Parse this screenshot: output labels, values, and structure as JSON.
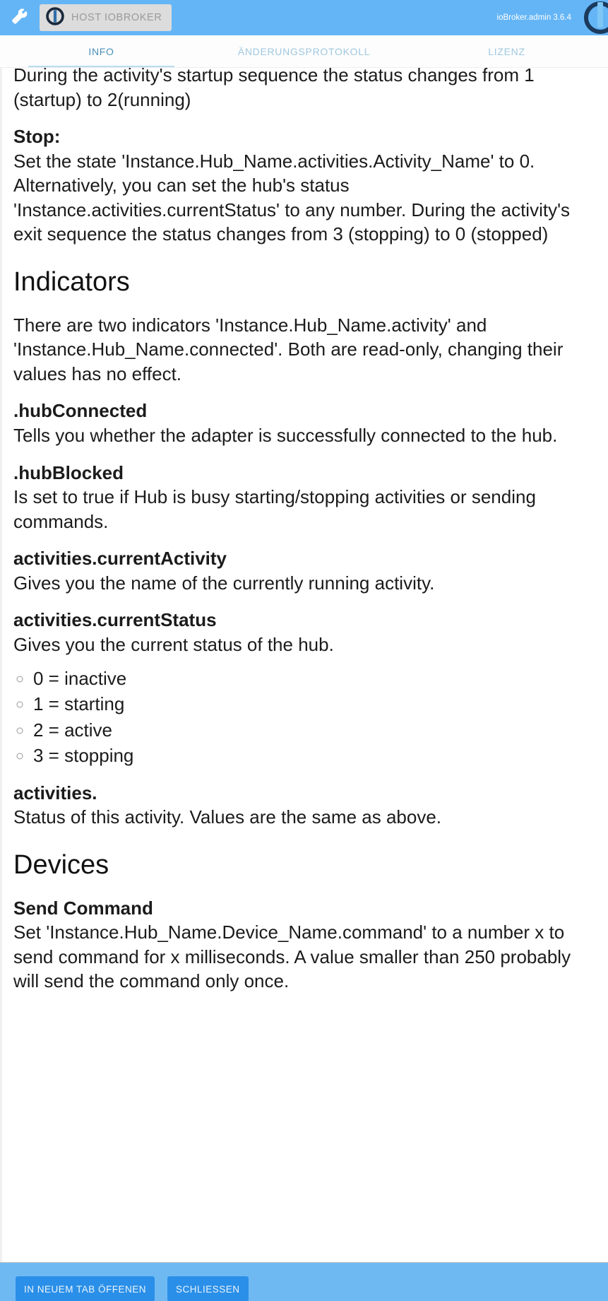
{
  "appbar": {
    "menu_icon": "wrench-icon",
    "host_chip_label": "HOST IOBROKER",
    "host_chip_icon": "iobroker-logo-icon",
    "version_label": "ioBroker.admin 3.6.4",
    "corner_icon": "iobroker-logo-icon",
    "background_color": "#64b5f6"
  },
  "tabs": [
    {
      "label": "INFO",
      "active": true
    },
    {
      "label": "ÄNDERUNGSPROTOKOLL",
      "active": false
    },
    {
      "label": "LIZENZ",
      "active": false
    }
  ],
  "tab_colors": {
    "active_text": "#4a90b8",
    "inactive_text": "#9fc8e0",
    "indicator": "#b9dcee"
  },
  "document": {
    "intro_clipped": "During the activity's startup sequence the status changes from 1 (startup) to 2(running)",
    "stop_heading": "Stop:",
    "stop_body": "Set the state 'Instance.Hub_Name.activities.Activity_Name' to 0. Alternatively, you can set the hub's status 'Instance.activities.currentStatus' to any number. During the activity's exit sequence the status changes from 3 (stopping) to 0 (stopped)",
    "indicators_heading": "Indicators",
    "indicators_intro": "There are two indicators 'Instance.Hub_Name.activity' and 'Instance.Hub_Name.connected'. Both are read-only, changing their values has no effect.",
    "entries": [
      {
        "term": ".hubConnected",
        "desc": "Tells you whether the adapter is successfully connected to the hub."
      },
      {
        "term": ".hubBlocked",
        "desc": "Is set to true if Hub is busy starting/stopping activities or sending commands."
      },
      {
        "term": "activities.currentActivity",
        "desc": "Gives you the name of the currently running activity."
      },
      {
        "term": "activities.currentStatus",
        "desc": "Gives you the current status of the hub."
      }
    ],
    "status_values": [
      "0 = inactive",
      "1 = starting",
      "2 = active",
      "3 = stopping"
    ],
    "activities_term": "activities.",
    "activities_desc": "Status of this activity. Values are the same as above.",
    "devices_heading": "Devices",
    "send_command_term": "Send Command",
    "send_command_desc": "Set 'Instance.Hub_Name.Device_Name.command' to a number x to send command for x milliseconds. A value smaller than 250 probably will send the command only once."
  },
  "bottombar": {
    "open_new_tab_label": "IN NEUEM TAB ÖFFENEN",
    "close_label": "SCHLIESSEN",
    "background_color": "#6fb9f3",
    "button_color": "#2a8fe8"
  }
}
